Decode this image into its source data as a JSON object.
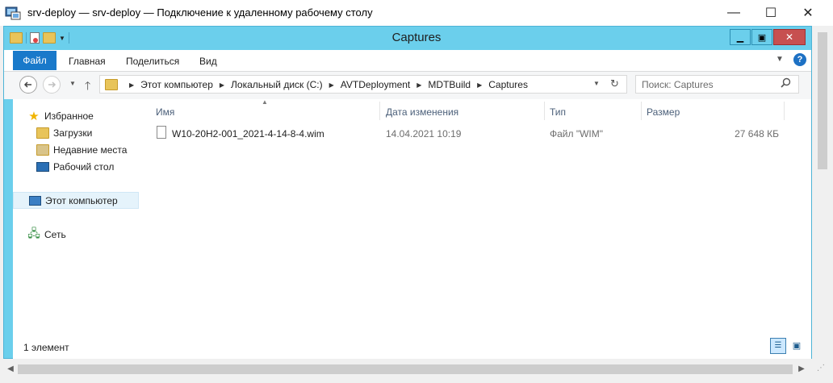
{
  "rdp": {
    "title": "srv-deploy — srv-deploy — Подключение к удаленному рабочему столу",
    "minimize": "—",
    "maximize": "☐",
    "close": "✕"
  },
  "explorer": {
    "title": "Captures",
    "minimize": "▁",
    "maximize": "▣",
    "close": "✕"
  },
  "ribbon": {
    "tabs": [
      "Файл",
      "Главная",
      "Поделиться",
      "Вид"
    ],
    "help": "?"
  },
  "address": {
    "crumbs": [
      "Этот компьютер",
      "Локальный диск (C:)",
      "AVTDeployment",
      "MDTBuild",
      "Captures"
    ]
  },
  "search": {
    "placeholder": "Поиск: Captures"
  },
  "nav": {
    "favorites": "Избранное",
    "downloads": "Загрузки",
    "recent": "Недавние места",
    "desktop": "Рабочий стол",
    "thispc": "Этот компьютер",
    "network": "Сеть"
  },
  "columns": {
    "name": "Имя",
    "date": "Дата изменения",
    "type": "Тип",
    "size": "Размер"
  },
  "files": [
    {
      "name": "W10-20H2-001_2021-4-14-8-4.wim",
      "date": "14.04.2021 10:19",
      "type": "Файл \"WIM\"",
      "size": "27 648 КБ"
    }
  ],
  "status": {
    "count": "1 элемент"
  },
  "colors": {
    "explorer_frame": "#6bcfec",
    "file_tab": "#1979ca",
    "selected_nav": "#e5f3fb",
    "close_button": "#c75050"
  }
}
